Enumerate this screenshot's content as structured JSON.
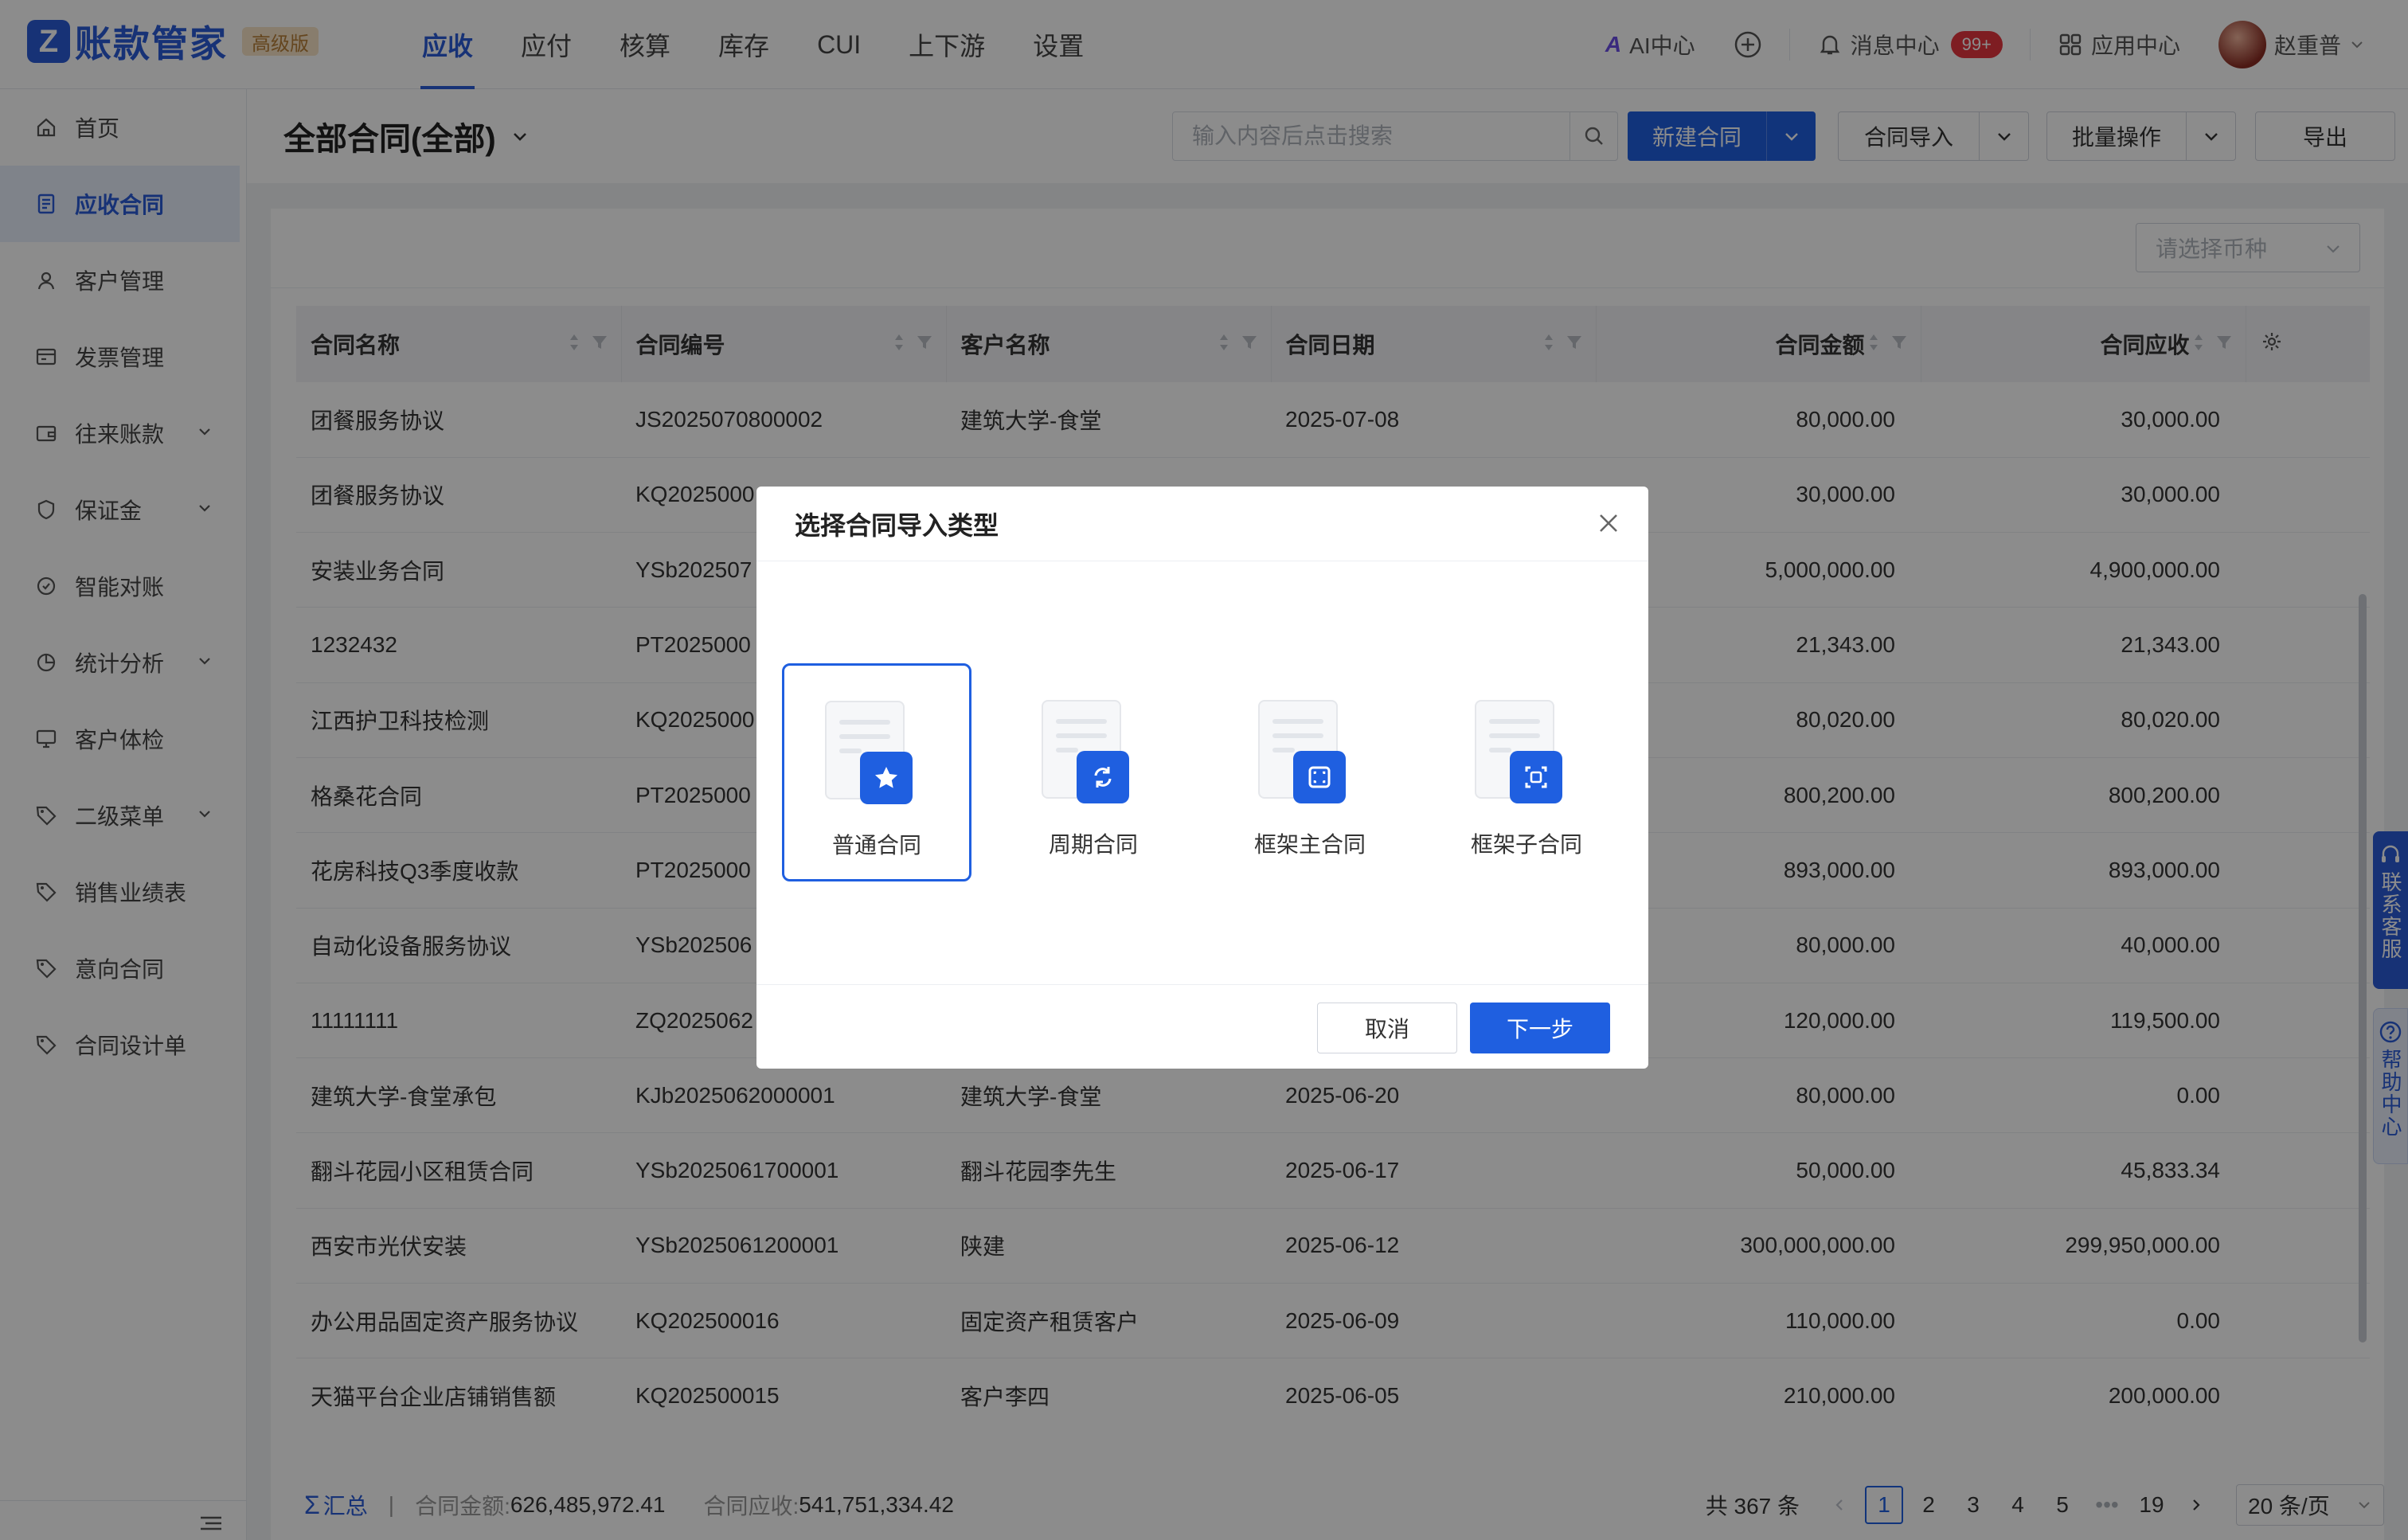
{
  "app": {
    "logo_mark": "Z",
    "logo_text": "账款管家",
    "edition_badge": "高级版"
  },
  "topnav": [
    "应收",
    "应付",
    "核算",
    "库存",
    "CUI",
    "上下游",
    "设置"
  ],
  "topright": {
    "ai_label": "AI中心",
    "messages_label": "消息中心",
    "messages_count": "99+",
    "apps_label": "应用中心",
    "user_name": "赵重普"
  },
  "sidebar": {
    "items": [
      {
        "label": "首页",
        "icon": "home-icon"
      },
      {
        "label": "应收合同",
        "icon": "contract-icon",
        "active": true
      },
      {
        "label": "客户管理",
        "icon": "user-icon"
      },
      {
        "label": "发票管理",
        "icon": "invoice-icon"
      },
      {
        "label": "往来账款",
        "icon": "wallet-icon",
        "expandable": true
      },
      {
        "label": "保证金",
        "icon": "shield-icon",
        "expandable": true
      },
      {
        "label": "智能对账",
        "icon": "sync-icon"
      },
      {
        "label": "统计分析",
        "icon": "pie-chart-icon",
        "expandable": true
      },
      {
        "label": "客户体检",
        "icon": "monitor-icon"
      },
      {
        "label": "二级菜单",
        "icon": "tag-icon",
        "expandable": true
      },
      {
        "label": "销售业绩表",
        "icon": "tag-icon"
      },
      {
        "label": "意向合同",
        "icon": "tag-icon"
      },
      {
        "label": "合同设计单",
        "icon": "tag-icon"
      }
    ]
  },
  "page": {
    "title": "全部合同(全部)",
    "search_placeholder": "输入内容后点击搜索",
    "new_contract": "新建合同",
    "import_contract": "合同导入",
    "batch_ops": "批量操作",
    "export": "导出",
    "currency_placeholder": "请选择币种"
  },
  "table": {
    "columns": [
      "合同名称",
      "合同编号",
      "客户名称",
      "合同日期",
      "合同金额",
      "合同应收"
    ],
    "rows": [
      [
        "团餐服务协议",
        "JS2025070800002",
        "建筑大学-食堂",
        "2025-07-08",
        "80,000.00",
        "30,000.00"
      ],
      [
        "团餐服务协议",
        "KQ2025000",
        "",
        "",
        "30,000.00",
        "30,000.00"
      ],
      [
        "安装业务合同",
        "YSb202507",
        "",
        "",
        "5,000,000.00",
        "4,900,000.00"
      ],
      [
        "1232432",
        "PT2025000",
        "",
        "",
        "21,343.00",
        "21,343.00"
      ],
      [
        "江西护卫科技检测",
        "KQ2025000",
        "",
        "",
        "80,020.00",
        "80,020.00"
      ],
      [
        "格桑花合同",
        "PT2025000",
        "",
        "",
        "800,200.00",
        "800,200.00"
      ],
      [
        "花房科技Q3季度收款",
        "PT2025000",
        "",
        "",
        "893,000.00",
        "893,000.00"
      ],
      [
        "自动化设备服务协议",
        "YSb202506",
        "",
        "",
        "80,000.00",
        "40,000.00"
      ],
      [
        "11111111",
        "ZQ2025062",
        "",
        "",
        "120,000.00",
        "119,500.00"
      ],
      [
        "建筑大学-食堂承包",
        "KJb2025062000001",
        "建筑大学-食堂",
        "2025-06-20",
        "80,000.00",
        "0.00"
      ],
      [
        "翻斗花园小区租赁合同",
        "YSb2025061700001",
        "翻斗花园李先生",
        "2025-06-17",
        "50,000.00",
        "45,833.34"
      ],
      [
        "西安市光伏安装",
        "YSb2025061200001",
        "陕建",
        "2025-06-12",
        "300,000,000.00",
        "299,950,000.00"
      ],
      [
        "办公用品固定资产服务协议",
        "KQ202500016",
        "固定资产租赁客户",
        "2025-06-09",
        "110,000.00",
        "0.00"
      ],
      [
        "天猫平台企业店铺销售额",
        "KQ202500015",
        "客户李四",
        "2025-06-05",
        "210,000.00",
        "200,000.00"
      ]
    ]
  },
  "footer": {
    "sum_label": "汇总",
    "amount_label": "合同金额:",
    "amount_value": "626,485,972.41",
    "receivable_label": "合同应收:",
    "receivable_value": "541,751,334.42",
    "total": "共 367 条",
    "pages": [
      "1",
      "2",
      "3",
      "4",
      "5",
      "•••",
      "19"
    ],
    "page_size": "20 条/页"
  },
  "float": {
    "service": "联系客服",
    "help": "帮助中心"
  },
  "modal": {
    "title": "选择合同导入类型",
    "types": [
      {
        "label": "普通合同",
        "icon": "star-icon",
        "selected": true
      },
      {
        "label": "周期合同",
        "icon": "cycle-icon"
      },
      {
        "label": "框架主合同",
        "icon": "frame-main-icon"
      },
      {
        "label": "框架子合同",
        "icon": "frame-sub-icon"
      }
    ],
    "cancel": "取消",
    "next": "下一步"
  },
  "colors": {
    "primary": "#1f5fe0",
    "brand": "#2a5bd7",
    "danger": "#e5353f"
  }
}
